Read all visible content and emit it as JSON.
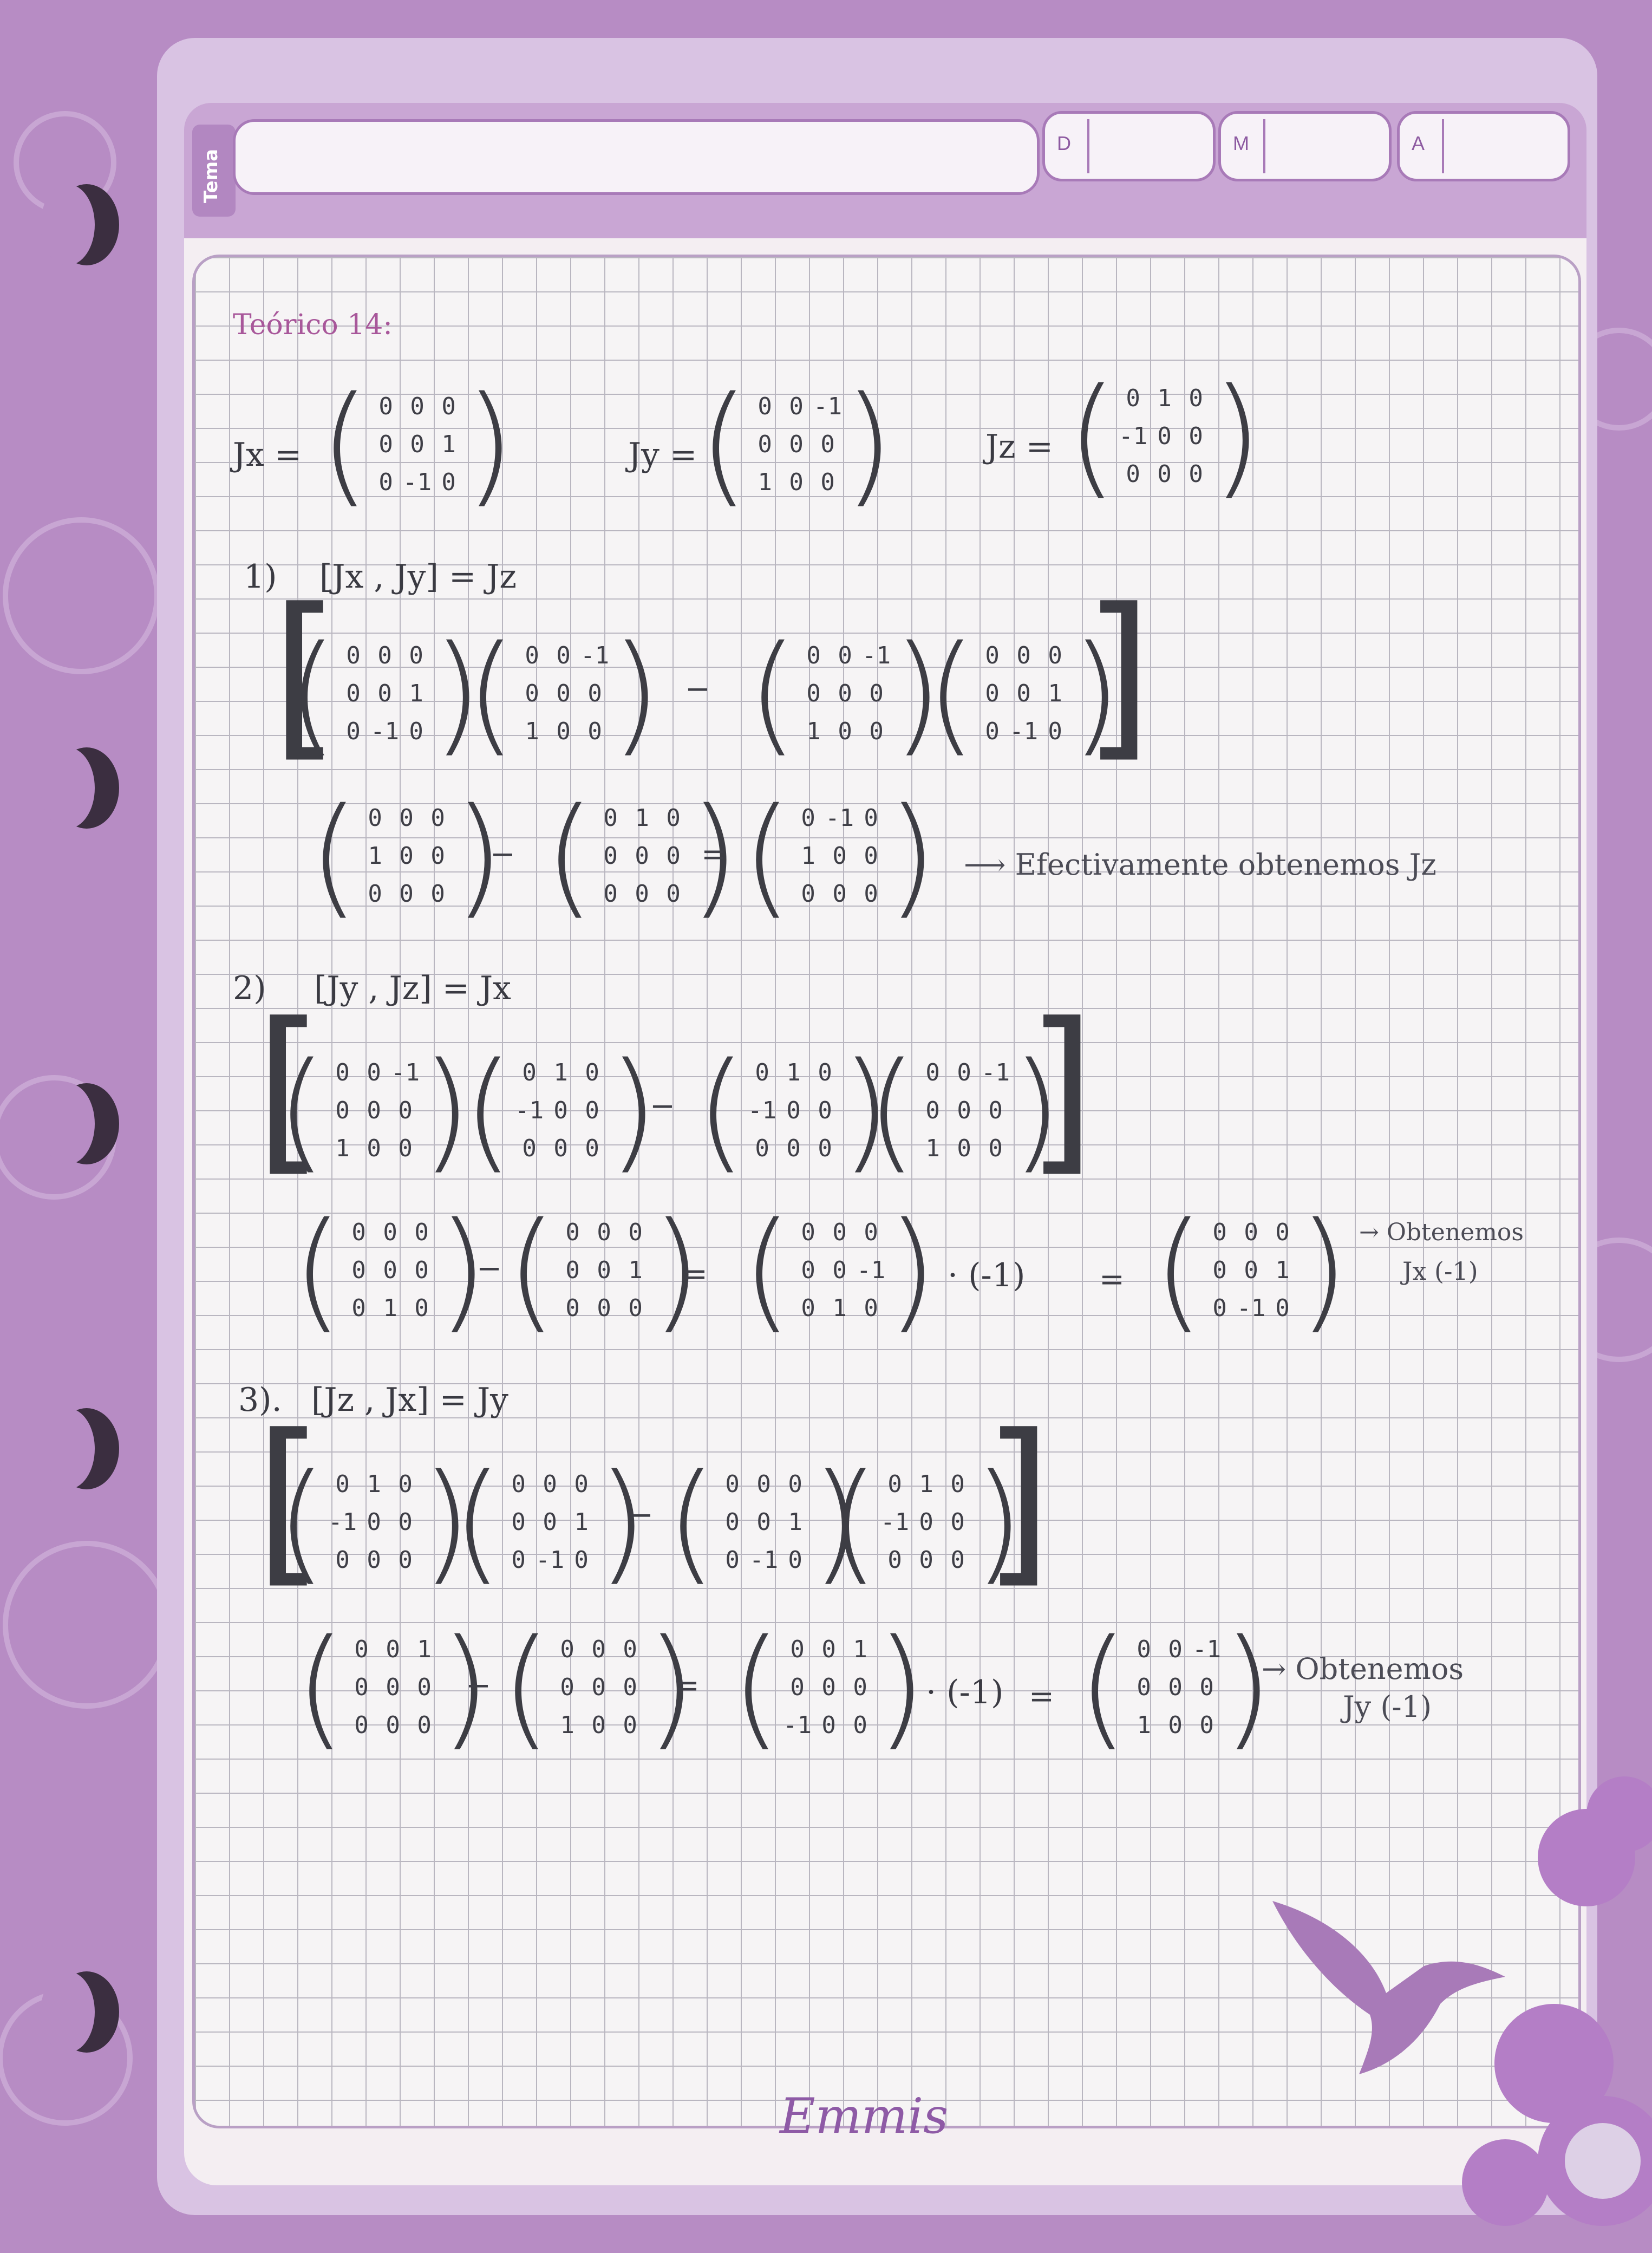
{
  "header": {
    "tema_label": "Tema",
    "date_d": "D",
    "date_m": "M",
    "date_a": "A"
  },
  "title": "Teórico 14:",
  "defs": {
    "jx_label": "Jx =",
    "jy_label": "Jy =",
    "jz_label": "Jz =",
    "jx": [
      "0",
      "0",
      "0",
      "0",
      "0",
      "1",
      "0",
      "-1",
      "0"
    ],
    "jy": [
      "0",
      "0",
      "-1",
      "0",
      "0",
      "0",
      "1",
      "0",
      "0"
    ],
    "jz": [
      "0",
      "1",
      "0",
      "-1",
      "0",
      "0",
      "0",
      "0",
      "0"
    ]
  },
  "p1": {
    "label": "1)",
    "eq": "[Jx , Jy] = Jz",
    "a": [
      "0",
      "0",
      "0",
      "0",
      "0",
      "1",
      "0",
      "-1",
      "0"
    ],
    "b": [
      "0",
      "0",
      "-1",
      "0",
      "0",
      "0",
      "1",
      "0",
      "0"
    ],
    "c": [
      "0",
      "0",
      "-1",
      "0",
      "0",
      "0",
      "1",
      "0",
      "0"
    ],
    "d": [
      "0",
      "0",
      "0",
      "0",
      "0",
      "1",
      "0",
      "-1",
      "0"
    ],
    "r1": [
      "0",
      "0",
      "0",
      "1",
      "0",
      "0",
      "0",
      "0",
      "0"
    ],
    "r2": [
      "0",
      "1",
      "0",
      "0",
      "0",
      "0",
      "0",
      "0",
      "0"
    ],
    "r3": [
      "0",
      "-1",
      "0",
      "1",
      "0",
      "0",
      "0",
      "0",
      "0"
    ],
    "note": "⟶ Efectivamente obtenemos  Jz"
  },
  "p2": {
    "label": "2)",
    "eq": "[Jy , Jz] = Jx",
    "a": [
      "0",
      "0",
      "-1",
      "0",
      "0",
      "0",
      "1",
      "0",
      "0"
    ],
    "b": [
      "0",
      "1",
      "0",
      "-1",
      "0",
      "0",
      "0",
      "0",
      "0"
    ],
    "c": [
      "0",
      "1",
      "0",
      "-1",
      "0",
      "0",
      "0",
      "0",
      "0"
    ],
    "d": [
      "0",
      "0",
      "-1",
      "0",
      "0",
      "0",
      "1",
      "0",
      "0"
    ],
    "r1": [
      "0",
      "0",
      "0",
      "0",
      "0",
      "0",
      "0",
      "1",
      "0"
    ],
    "r2": [
      "0",
      "0",
      "0",
      "0",
      "0",
      "1",
      "0",
      "0",
      "0"
    ],
    "r3": [
      "0",
      "0",
      "0",
      "0",
      "0",
      "-1",
      "0",
      "1",
      "0"
    ],
    "mult": "· (-1)",
    "r4": [
      "0",
      "0",
      "0",
      "0",
      "0",
      "1",
      "0",
      "-1",
      "0"
    ],
    "note1": "→ Obtenemos",
    "note2": "Jx (-1)"
  },
  "p3": {
    "label": "3).",
    "eq": "[Jz , Jx] = Jy",
    "a": [
      "0",
      "1",
      "0",
      "-1",
      "0",
      "0",
      "0",
      "0",
      "0"
    ],
    "b": [
      "0",
      "0",
      "0",
      "0",
      "0",
      "1",
      "0",
      "-1",
      "0"
    ],
    "c": [
      "0",
      "0",
      "0",
      "0",
      "0",
      "1",
      "0",
      "-1",
      "0"
    ],
    "d": [
      "0",
      "1",
      "0",
      "-1",
      "0",
      "0",
      "0",
      "0",
      "0"
    ],
    "r1": [
      "0",
      "0",
      "1",
      "0",
      "0",
      "0",
      "0",
      "0",
      "0"
    ],
    "r2": [
      "0",
      "0",
      "0",
      "0",
      "0",
      "0",
      "1",
      "0",
      "0"
    ],
    "r3": [
      "0",
      "0",
      "1",
      "0",
      "0",
      "0",
      "-1",
      "0",
      "0"
    ],
    "mult": "· (-1)",
    "r4": [
      "0",
      "0",
      "-1",
      "0",
      "0",
      "0",
      "1",
      "0",
      "0"
    ],
    "note1": "→ Obtenemos",
    "note2": "Jy (-1)"
  },
  "ops": {
    "minus": "−",
    "equals": "="
  },
  "brand": "Emmis"
}
